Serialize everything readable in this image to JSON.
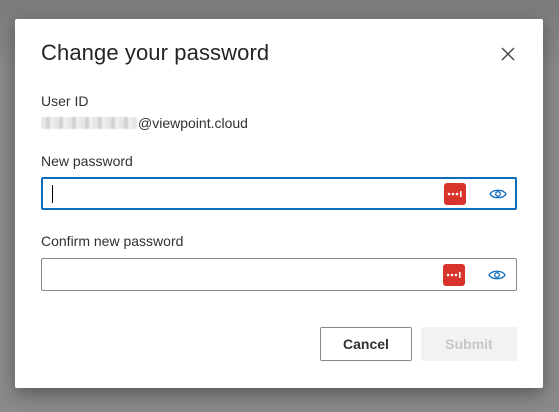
{
  "dialog": {
    "title": "Change your password",
    "user_id_label": "User ID",
    "user_id_domain": "@viewpoint.cloud",
    "new_password_label": "New password",
    "new_password_value": "",
    "confirm_password_label": "Confirm new password",
    "confirm_password_value": "",
    "cancel_label": "Cancel",
    "submit_label": "Submit",
    "submit_disabled": true
  },
  "icons": {
    "close": "close-icon",
    "password_manager": "password-manager-icon",
    "reveal": "eye-icon"
  },
  "colors": {
    "accent": "#0f6cbd",
    "password_manager_red": "#d9342b",
    "disabled_text": "#c8c6c4",
    "disabled_bg": "#f3f2f1"
  }
}
